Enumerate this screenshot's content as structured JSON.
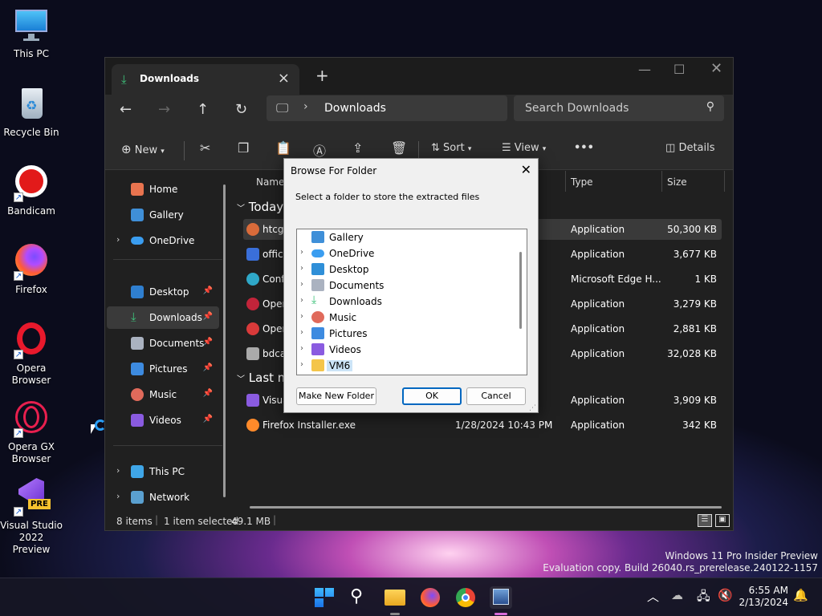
{
  "desktop": {
    "icons": [
      {
        "label": "This PC"
      },
      {
        "label": "Recycle Bin"
      },
      {
        "label": "Bandicam"
      },
      {
        "label": "Firefox"
      },
      {
        "label": "Opera Browser"
      },
      {
        "label": "Opera GX Browser"
      },
      {
        "label": "Visual Studio 2022 Preview",
        "badge": "PRE"
      }
    ]
  },
  "explorer": {
    "tab_title": "Downloads",
    "new_tab": "+",
    "address": {
      "current": "Downloads",
      "separator": "›"
    },
    "search": {
      "placeholder": "Search Downloads"
    },
    "commands": {
      "new": "New",
      "sort": "Sort",
      "view": "View",
      "more": "•••",
      "details": "Details"
    },
    "nav": [
      {
        "label": "Home",
        "color": "#e8744f"
      },
      {
        "label": "Gallery",
        "color": "#3f8fd8"
      },
      {
        "label": "OneDrive",
        "color": "#3a9df0"
      },
      {
        "label": "Desktop",
        "color": "#2f7fd0"
      },
      {
        "label": "Downloads",
        "color": "#3ec27a"
      },
      {
        "label": "Documents",
        "color": "#aab2c0"
      },
      {
        "label": "Pictures",
        "color": "#3d8be0"
      },
      {
        "label": "Music",
        "color": "#e06a5b"
      },
      {
        "label": "Videos",
        "color": "#8a5be0"
      },
      {
        "label": "This PC",
        "color": "#3fa6e8"
      },
      {
        "label": "Network",
        "color": "#5aa0d0"
      }
    ],
    "columns": {
      "name": "Name",
      "type": "Type",
      "size": "Size"
    },
    "groups": {
      "today": "Today",
      "last": "Last m"
    },
    "files": [
      {
        "name": "htcg",
        "type": "Application",
        "size": "50,300 KB",
        "color": "#d96b3a"
      },
      {
        "name": "office",
        "type": "Application",
        "size": "3,677 KB",
        "color": "#3a6fd9"
      },
      {
        "name": "Conf",
        "type": "Microsoft Edge H...",
        "size": "1 KB",
        "color": "#2fa8c8"
      },
      {
        "name": "Oper",
        "type": "Application",
        "size": "3,279 KB",
        "color": "#c2243a"
      },
      {
        "name": "Oper",
        "type": "Application",
        "size": "2,881 KB",
        "color": "#d93a3a"
      },
      {
        "name": "bdca",
        "type": "Application",
        "size": "32,028 KB",
        "color": "#aaaaaa"
      }
    ],
    "files_last": [
      {
        "name": "Visua",
        "date": "",
        "type": "Application",
        "size": "3,909 KB",
        "color": "#8a5be0"
      },
      {
        "name": "Firefox Installer.exe",
        "date": "1/28/2024 10:43 PM",
        "type": "Application",
        "size": "342 KB",
        "color": "#ff8a2a"
      }
    ],
    "status": {
      "count": "8 items",
      "selected": "1 item selected",
      "size": "49.1 MB"
    }
  },
  "dialog": {
    "title": "Browse For Folder",
    "instruction": "Select a folder to store the extracted files",
    "tree": [
      {
        "label": "Gallery",
        "color": "#3f8fd8",
        "chev": ""
      },
      {
        "label": "OneDrive",
        "color": "#3a9df0",
        "chev": "›"
      },
      {
        "label": "Desktop",
        "color": "#2f8fd8",
        "chev": "›"
      },
      {
        "label": "Documents",
        "color": "#aab2c0",
        "chev": "›"
      },
      {
        "label": "Downloads",
        "color": "#3ec27a",
        "chev": "›"
      },
      {
        "label": "Music",
        "color": "#e06a5b",
        "chev": "›"
      },
      {
        "label": "Pictures",
        "color": "#3d8be0",
        "chev": "›"
      },
      {
        "label": "Videos",
        "color": "#8a5be0",
        "chev": "›"
      },
      {
        "label": "VM6",
        "color": "#f4c54a",
        "chev": "›"
      }
    ],
    "make_new_folder": "Make New Folder",
    "ok": "OK",
    "cancel": "Cancel"
  },
  "watermark": {
    "line1": "Windows 11 Pro Insider Preview",
    "line2": "Evaluation copy. Build 26040.rs_prerelease.240122-1157"
  },
  "clock": {
    "time": "6:55 AM",
    "date": "2/13/2024"
  }
}
